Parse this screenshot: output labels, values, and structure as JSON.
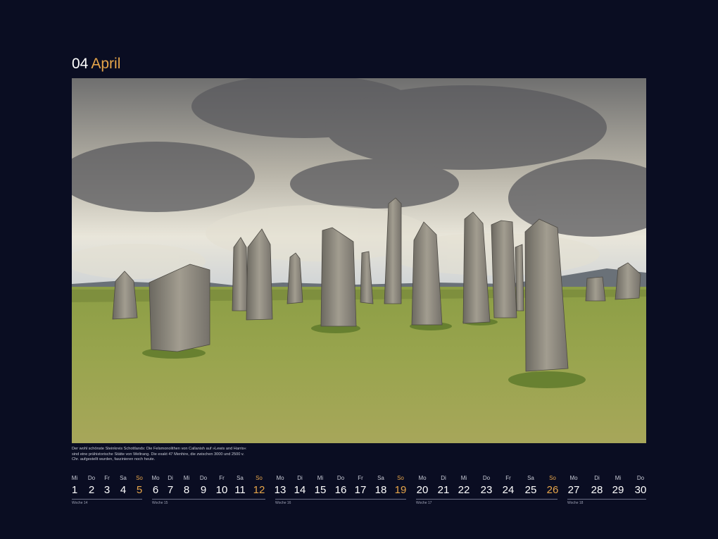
{
  "header": {
    "month_number": "04",
    "month_name": "April"
  },
  "photo": {
    "subject": "photo"
  },
  "caption": "Der wohl schönste Steinkreis Schottlands: Die Felsmonolithen von Callanish auf »Lewis and Harris« sind eine prähistorische Stätte von Weltrang. Die exakt 47 Menhire, die zwischen 3000 und 2500 v. Chr. aufgestellt wurden, faszinieren noch heute.",
  "days": [
    {
      "dow": "Mi",
      "num": "1"
    },
    {
      "dow": "Do",
      "num": "2"
    },
    {
      "dow": "Fr",
      "num": "3"
    },
    {
      "dow": "Sa",
      "num": "4"
    },
    {
      "dow": "So",
      "num": "5"
    },
    {
      "dow": "Mo",
      "num": "6"
    },
    {
      "dow": "Di",
      "num": "7"
    },
    {
      "dow": "Mi",
      "num": "8"
    },
    {
      "dow": "Do",
      "num": "9"
    },
    {
      "dow": "Fr",
      "num": "10"
    },
    {
      "dow": "Sa",
      "num": "11"
    },
    {
      "dow": "So",
      "num": "12"
    },
    {
      "dow": "Mo",
      "num": "13"
    },
    {
      "dow": "Di",
      "num": "14"
    },
    {
      "dow": "Mi",
      "num": "15"
    },
    {
      "dow": "Do",
      "num": "16"
    },
    {
      "dow": "Fr",
      "num": "17"
    },
    {
      "dow": "Sa",
      "num": "18"
    },
    {
      "dow": "So",
      "num": "19"
    },
    {
      "dow": "Mo",
      "num": "20"
    },
    {
      "dow": "Di",
      "num": "21"
    },
    {
      "dow": "Mi",
      "num": "22"
    },
    {
      "dow": "Do",
      "num": "23"
    },
    {
      "dow": "Fr",
      "num": "24"
    },
    {
      "dow": "Sa",
      "num": "25"
    },
    {
      "dow": "So",
      "num": "26"
    },
    {
      "dow": "Mo",
      "num": "27"
    },
    {
      "dow": "Di",
      "num": "28"
    },
    {
      "dow": "Mi",
      "num": "29"
    },
    {
      "dow": "Do",
      "num": "30"
    }
  ],
  "weeks": [
    "Woche 14",
    "Woche 15",
    "Woche 16",
    "Woche 17",
    "Woche 18"
  ],
  "colors": {
    "background": "#0a0d22",
    "accent": "#e6a54a",
    "text": "#ffffff"
  }
}
